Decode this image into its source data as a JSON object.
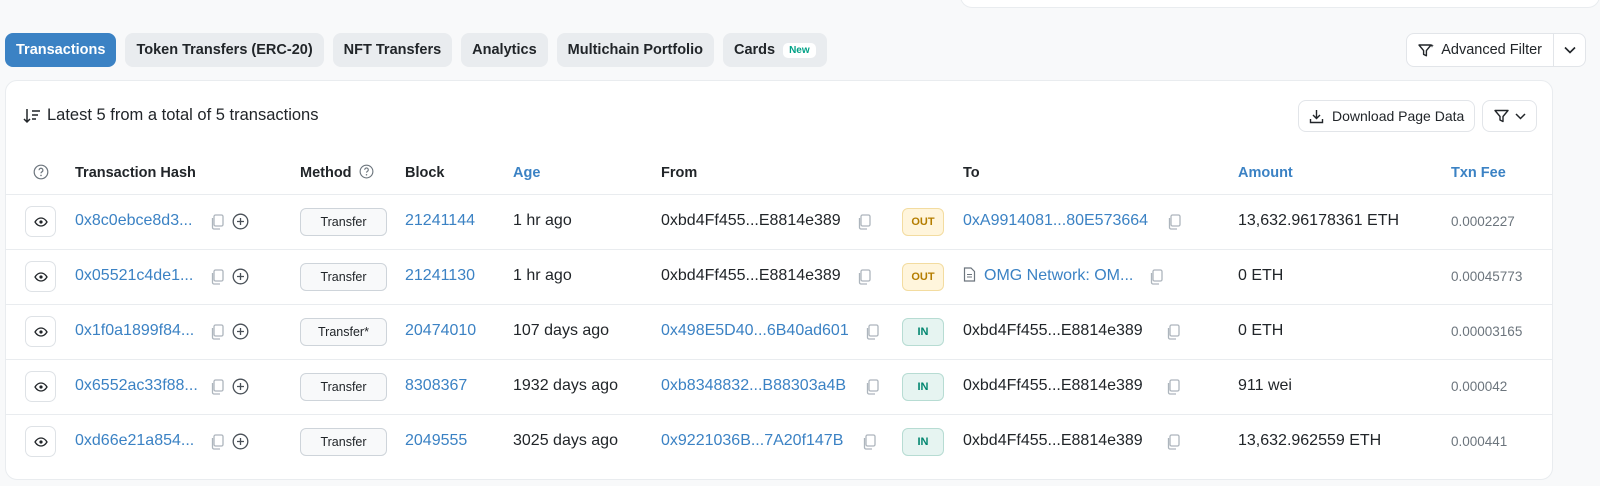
{
  "tabs": [
    {
      "label": "Transactions",
      "active": true
    },
    {
      "label": "Token Transfers (ERC-20)",
      "active": false
    },
    {
      "label": "NFT Transfers",
      "active": false
    },
    {
      "label": "Analytics",
      "active": false
    },
    {
      "label": "Multichain Portfolio",
      "active": false
    },
    {
      "label": "Cards",
      "active": false,
      "badge": "New"
    }
  ],
  "advanced_filter": {
    "label": "Advanced Filter"
  },
  "summary": "Latest 5 from a total of 5 transactions",
  "download_label": "Download Page Data",
  "columns": {
    "hash": "Transaction Hash",
    "method": "Method",
    "block": "Block",
    "age": "Age",
    "from": "From",
    "to": "To",
    "amount": "Amount",
    "fee": "Txn Fee"
  },
  "rows": [
    {
      "hash": "0x8c0ebce8d3...",
      "method": "Transfer",
      "block": "21241144",
      "age": "1 hr ago",
      "from": "0xbd4Ff455...E8814e389",
      "from_link": false,
      "direction": "OUT",
      "to": "0xA9914081...80E573664",
      "to_link": true,
      "to_contract": false,
      "amount": "13,632.96178361 ETH",
      "fee": "0.0002227"
    },
    {
      "hash": "0x05521c4de1...",
      "method": "Transfer",
      "block": "21241130",
      "age": "1 hr ago",
      "from": "0xbd4Ff455...E8814e389",
      "from_link": false,
      "direction": "OUT",
      "to": "OMG Network: OM...",
      "to_link": true,
      "to_contract": true,
      "amount": "0 ETH",
      "fee": "0.00045773"
    },
    {
      "hash": "0x1f0a1899f84...",
      "method": "Transfer*",
      "block": "20474010",
      "age": "107 days ago",
      "from": "0x498E5D40...6B40ad601",
      "from_link": true,
      "direction": "IN",
      "to": "0xbd4Ff455...E8814e389",
      "to_link": false,
      "to_contract": false,
      "amount": "0 ETH",
      "fee": "0.00003165"
    },
    {
      "hash": "0x6552ac33f88...",
      "method": "Transfer",
      "block": "8308367",
      "age": "1932 days ago",
      "from": "0xb8348832...B88303a4B",
      "from_link": true,
      "direction": "IN",
      "to": "0xbd4Ff455...E8814e389",
      "to_link": false,
      "to_contract": false,
      "amount": "911 wei",
      "fee": "0.000042"
    },
    {
      "hash": "0xd66e21a854...",
      "method": "Transfer",
      "block": "2049555",
      "age": "3025 days ago",
      "from": "0x9221036B...7A20f147B",
      "from_link": true,
      "direction": "IN",
      "to": "0xbd4Ff455...E8814e389",
      "to_link": false,
      "to_contract": false,
      "amount": "13,632.962559 ETH",
      "fee": "0.000441"
    }
  ],
  "colors": {
    "accent": "#3b82c4",
    "out": "#b47d00",
    "in": "#00856f"
  }
}
